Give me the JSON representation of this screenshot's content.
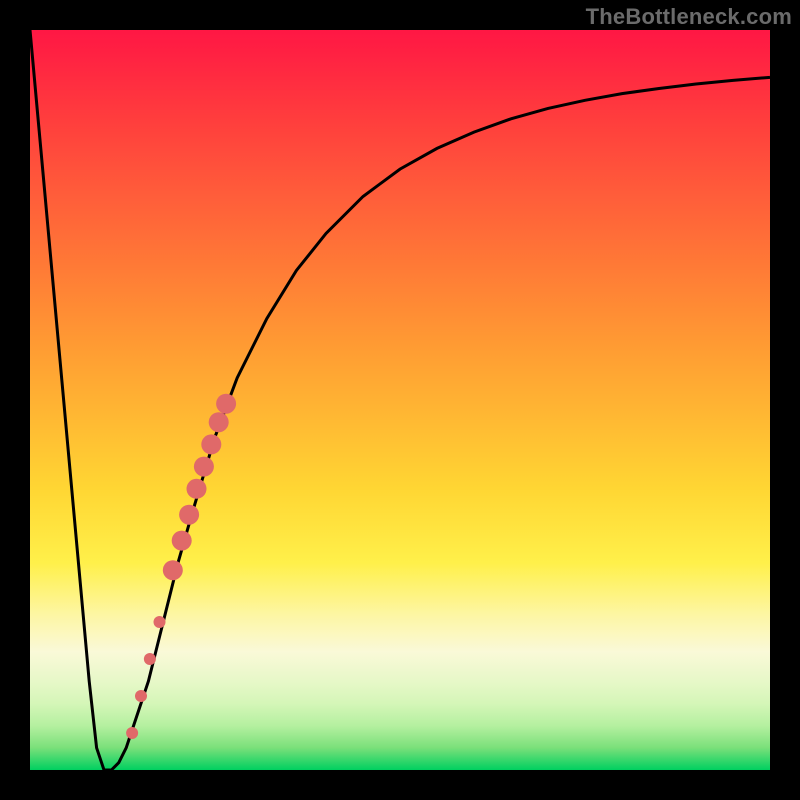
{
  "watermark": "TheBottleneck.com",
  "colors": {
    "background": "#000000",
    "curve": "#000000",
    "markers": "#e06969",
    "gradient_top": "#ff1744",
    "gradient_mid": "#ffd633",
    "gradient_bottom": "#00d060"
  },
  "chart_data": {
    "type": "line",
    "title": "",
    "xlabel": "",
    "ylabel": "",
    "xlim": [
      0,
      100
    ],
    "ylim": [
      0,
      100
    ],
    "grid": false,
    "series": [
      {
        "name": "bottleneck-curve",
        "x": [
          0,
          2,
          4,
          6,
          8,
          9,
          10,
          11,
          12,
          13,
          14,
          16,
          18,
          20,
          22,
          25,
          28,
          32,
          36,
          40,
          45,
          50,
          55,
          60,
          65,
          70,
          75,
          80,
          85,
          90,
          95,
          100
        ],
        "values": [
          100,
          78,
          56,
          34,
          12,
          3,
          0,
          0,
          1,
          3,
          6,
          12,
          20,
          28,
          35,
          45,
          53,
          61,
          67.5,
          72.5,
          77.5,
          81.2,
          84,
          86.2,
          88,
          89.4,
          90.5,
          91.4,
          92.1,
          92.7,
          93.2,
          93.6
        ]
      }
    ],
    "markers": [
      {
        "x": 13.8,
        "y": 5,
        "size": 6
      },
      {
        "x": 15.0,
        "y": 10,
        "size": 6
      },
      {
        "x": 16.2,
        "y": 15,
        "size": 6
      },
      {
        "x": 17.5,
        "y": 20,
        "size": 6
      },
      {
        "x": 19.3,
        "y": 27,
        "size": 10
      },
      {
        "x": 20.5,
        "y": 31,
        "size": 10
      },
      {
        "x": 21.5,
        "y": 34.5,
        "size": 10
      },
      {
        "x": 22.5,
        "y": 38,
        "size": 10
      },
      {
        "x": 23.5,
        "y": 41,
        "size": 10
      },
      {
        "x": 24.5,
        "y": 44,
        "size": 10
      },
      {
        "x": 25.5,
        "y": 47,
        "size": 10
      },
      {
        "x": 26.5,
        "y": 49.5,
        "size": 10
      }
    ]
  }
}
